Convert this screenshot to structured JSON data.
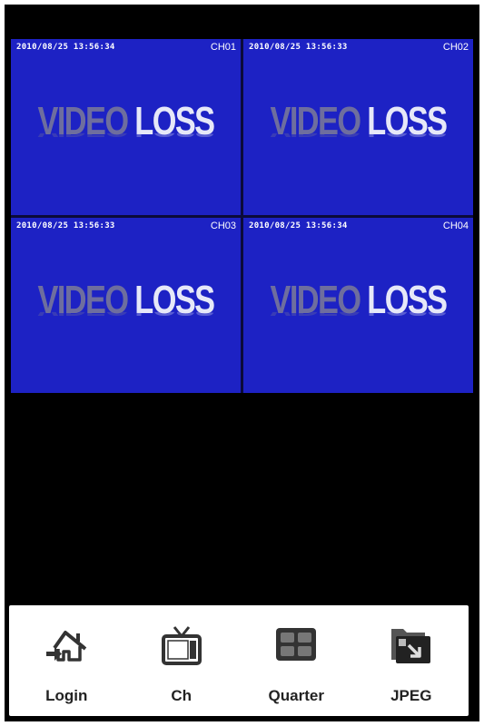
{
  "channels": [
    {
      "timestamp": "2010/08/25  13:56:34",
      "label": "CH01",
      "status_word1": "VIDEO",
      "status_word2": "LOSS"
    },
    {
      "timestamp": "2010/08/25  13:56:33",
      "label": "CH02",
      "status_word1": "VIDEO",
      "status_word2": "LOSS"
    },
    {
      "timestamp": "2010/08/25  13:56:33",
      "label": "CH03",
      "status_word1": "VIDEO",
      "status_word2": "LOSS"
    },
    {
      "timestamp": "2010/08/25  13:56:34",
      "label": "CH04",
      "status_word1": "VIDEO",
      "status_word2": "LOSS"
    }
  ],
  "toolbar": {
    "login_label": "Login",
    "ch_label": "Ch",
    "quarter_label": "Quarter",
    "jpeg_label": "JPEG"
  },
  "icons": {
    "login": "house-arrow-icon",
    "ch": "tv-icon",
    "quarter": "quad-grid-icon",
    "jpeg": "folder-save-icon"
  },
  "colors": {
    "tile_background": "#1d22c4",
    "screen_background": "#000000",
    "toolbar_background": "#ffffff"
  }
}
